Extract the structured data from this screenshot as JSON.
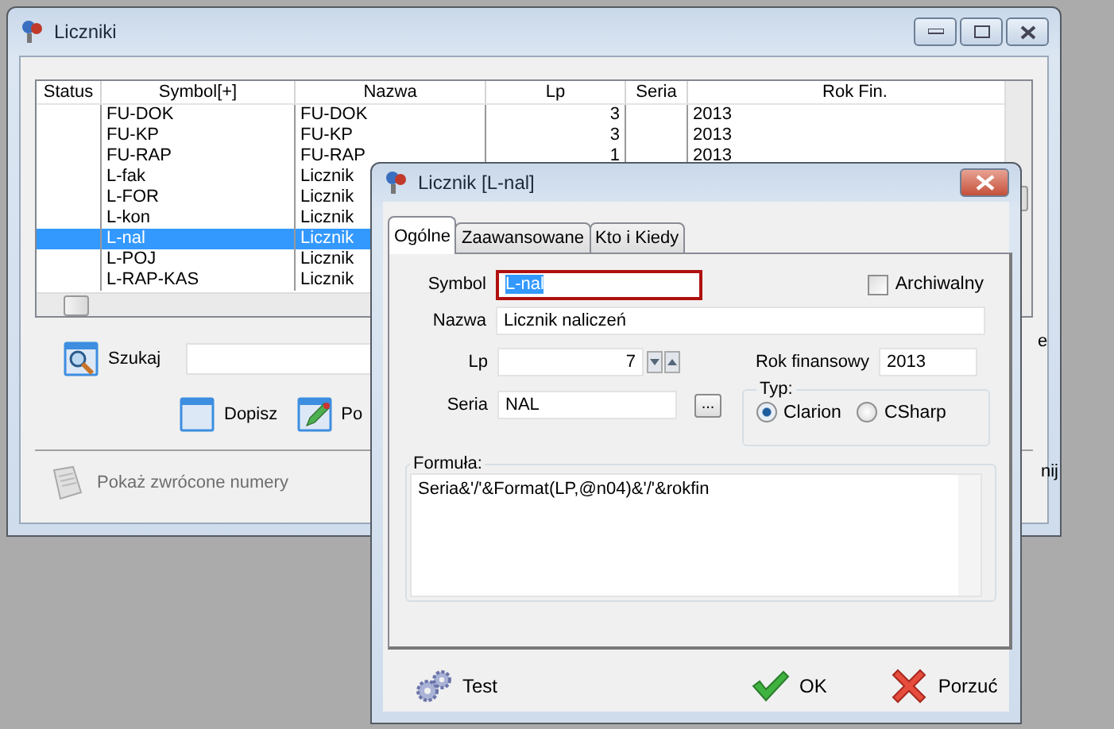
{
  "main_window": {
    "title": "Liczniki",
    "table": {
      "columns": [
        "Status",
        "Symbol[+]",
        "Nazwa",
        "Lp",
        "Seria",
        "Rok Fin."
      ],
      "rows": [
        {
          "symbol": "FU-DOK",
          "nazwa": "FU-DOK",
          "lp": "3",
          "rok_fin": "2013",
          "selected": false
        },
        {
          "symbol": "FU-KP",
          "nazwa": "FU-KP",
          "lp": "3",
          "rok_fin": "2013",
          "selected": false
        },
        {
          "symbol": "FU-RAP",
          "nazwa": "FU-RAP",
          "lp": "1",
          "rok_fin": "2013",
          "selected": false
        },
        {
          "symbol": "L-fak",
          "nazwa": "Licznik",
          "selected": false
        },
        {
          "symbol": "L-FOR",
          "nazwa": "Licznik",
          "selected": false
        },
        {
          "symbol": "L-kon",
          "nazwa": "Licznik",
          "selected": false
        },
        {
          "symbol": "L-nal",
          "nazwa": "Licznik",
          "selected": true
        },
        {
          "symbol": "L-POJ",
          "nazwa": "Licznik",
          "selected": false
        },
        {
          "symbol": "L-RAP-KAS",
          "nazwa": "Licznik",
          "selected": false
        }
      ]
    },
    "search": {
      "label": "Szukaj",
      "side_text": "e"
    },
    "buttons": [
      {
        "label": "Dopisz",
        "kind": "add"
      },
      {
        "label": "Po",
        "kind": "edit"
      }
    ],
    "returned_numbers": {
      "label": "Pokaż zwrócone numery",
      "disabled": true
    },
    "close_text": "nij"
  },
  "dialog": {
    "title": "Licznik [L-nal]",
    "tabs": [
      {
        "label": "Ogólne",
        "selected": true
      },
      {
        "label": "Zaawansowane",
        "selected": false
      },
      {
        "label": "Kto i Kiedy",
        "selected": false
      }
    ],
    "symbol": {
      "label": "Symbol",
      "value": "L-nal"
    },
    "archiwalny": {
      "label": "Archiwalny",
      "checked": false
    },
    "nazwa": {
      "label": "Nazwa",
      "value": "Licznik naliczeń"
    },
    "lp": {
      "label": "Lp",
      "value": "7"
    },
    "rok": {
      "label": "Rok finansowy",
      "value": "2013"
    },
    "seria": {
      "label": "Seria",
      "value": "NAL",
      "button": "..."
    },
    "typ": {
      "label": "Typ:",
      "options": [
        {
          "label": "Clarion",
          "selected": true
        },
        {
          "label": "CSharp",
          "selected": false
        }
      ]
    },
    "formula": {
      "label": "Formuła:",
      "value": "Seria&'/'&Format(LP,@n04)&'/'&rokfin"
    },
    "buttons": [
      {
        "label": "Test",
        "kind": "test"
      },
      {
        "label": "OK",
        "kind": "ok"
      },
      {
        "label": "Porzuć",
        "kind": "cancel"
      }
    ]
  }
}
